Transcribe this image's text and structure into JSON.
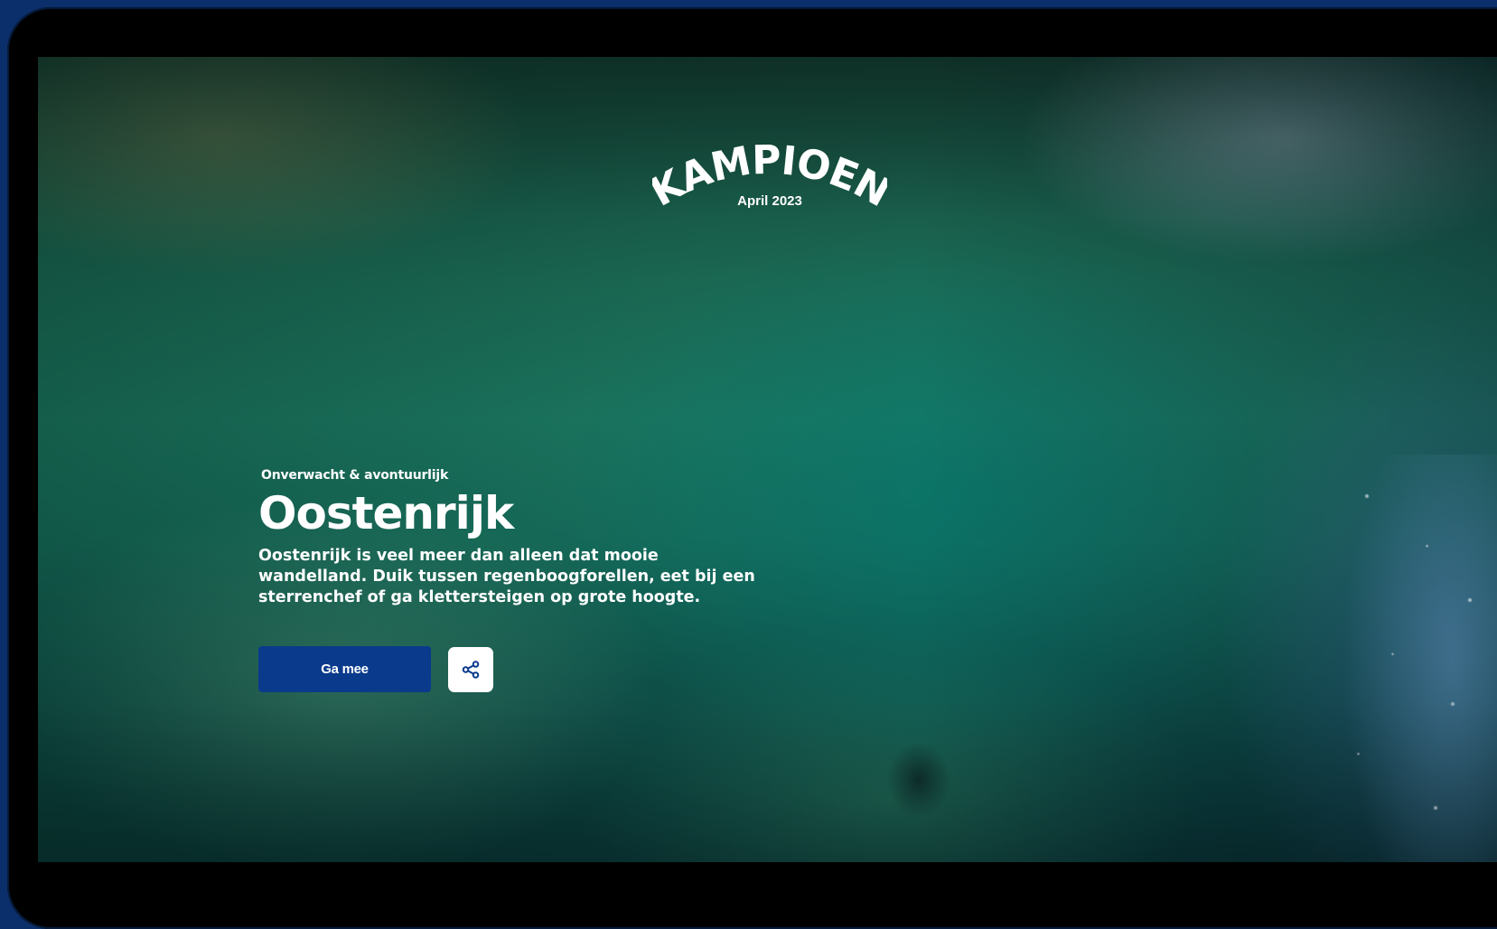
{
  "logo": {
    "brand": "KAMPIOEN",
    "issue": "April 2023"
  },
  "hero": {
    "eyebrow": "Onverwacht & avontuurlijk",
    "title": "Oostenrijk",
    "description": "Oostenrijk is veel meer dan alleen dat mooie wandelland. Duik tussen regenboogforellen, eet bij een sterrenchef of ga klettersteigen op grote hoogte.",
    "primary_button": "Ga mee",
    "share_icon": "share-icon"
  },
  "colors": {
    "primary": "#0a3a8c",
    "frame": "#0b2f6b",
    "text": "#ffffff"
  }
}
